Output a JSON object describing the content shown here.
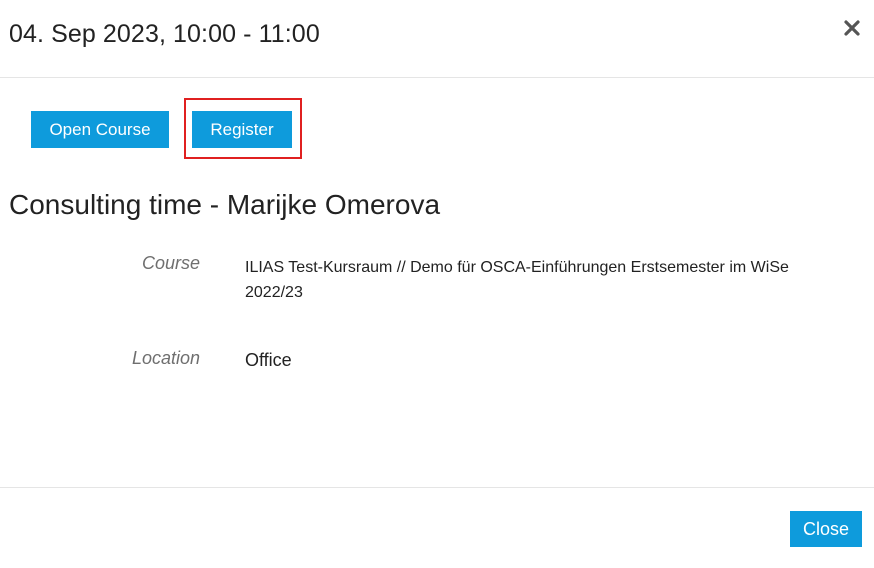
{
  "header": {
    "title": "04. Sep 2023, 10:00 - 11:00",
    "close_icon": "close-icon"
  },
  "actions": {
    "open_course_label": "Open Course",
    "register_label": "Register"
  },
  "item": {
    "title": "Consulting time - Marijke Omerova",
    "properties": [
      {
        "label": "Course",
        "value": "ILIAS Test-Kursraum // Demo für OSCA-Einführungen Erstsemester im WiSe 2022/23"
      },
      {
        "label": "Location",
        "value": "Office"
      }
    ]
  },
  "footer": {
    "close_label": "Close"
  },
  "colors": {
    "button_bg": "#0e9bdc",
    "button_text": "#ffffff",
    "highlight": "#e02020"
  }
}
